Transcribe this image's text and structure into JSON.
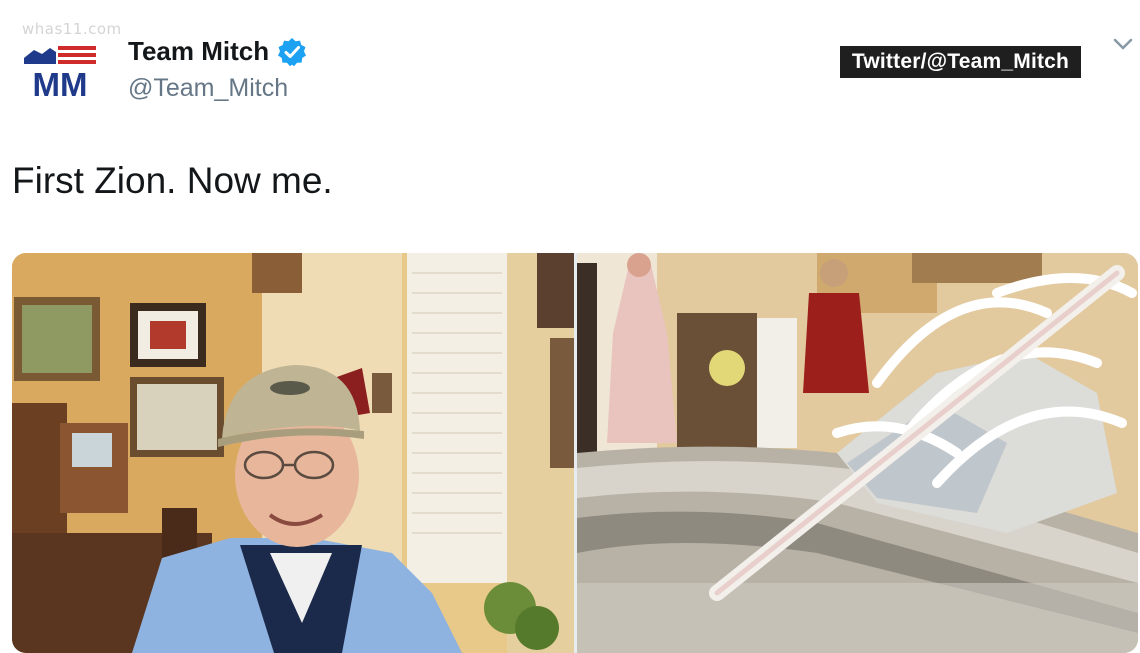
{
  "watermark": "whas11.com",
  "tweet": {
    "display_name": "Team Mitch",
    "handle": "@Team_Mitch",
    "verified": true,
    "text": "First Zion. Now me.",
    "avatar_text": "MM"
  },
  "source_badge": "Twitter/@Team_Mitch",
  "icons": {
    "verified": "verified-badge-icon",
    "menu": "chevron-down-icon"
  },
  "colors": {
    "verified_blue": "#1da1f2",
    "logo_navy": "#1f3a8a",
    "logo_red": "#d02b2b"
  },
  "media": [
    {
      "kind": "photo",
      "subject": "man in cap and blue shirt in a room with framed pictures"
    },
    {
      "kind": "photo",
      "subject": "worn white sneaker with broken sole"
    }
  ]
}
